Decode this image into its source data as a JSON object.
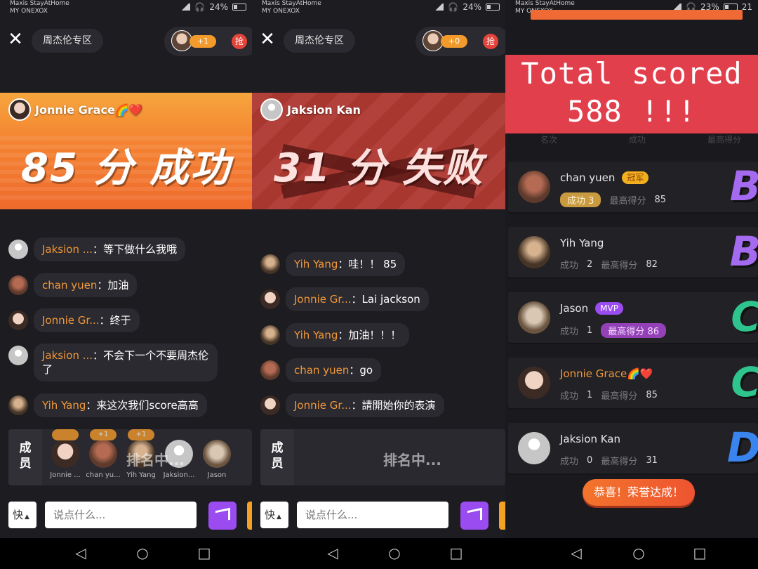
{
  "status_bars": [
    {
      "carrier1": "Maxis StayAtHome",
      "carrier2": "MY ONEXOX",
      "battery": "24%"
    },
    {
      "carrier1": "Maxis StayAtHome",
      "carrier2": "MY ONEXOX",
      "battery": "24%"
    },
    {
      "carrier1": "Maxis StayAtHome",
      "carrier2": "MY ONEXOX",
      "battery": "23%",
      "extra": "21"
    }
  ],
  "panel1": {
    "zone_title": "周杰伦专区",
    "plus_count": "+1",
    "grab_label": "抢",
    "banner": {
      "user": "Jonnie Grace🌈❤️",
      "result": "85 分 成功",
      "score": 85,
      "status": "成功"
    },
    "messages": [
      {
        "name": "Jaksion ...",
        "text": "等下做什么我哦"
      },
      {
        "name": "chan yuen",
        "text": "加油"
      },
      {
        "name": "Jonnie Gr...",
        "text": "终于"
      },
      {
        "name": "Jaksion ...",
        "text": "不会下一个不要周杰伦了"
      },
      {
        "name": "Yih Yang",
        "text": "来这次我们score高高"
      }
    ],
    "members_label": "成员",
    "members": [
      {
        "name": "Jonnie ...",
        "tag": ""
      },
      {
        "name": "chan yu...",
        "tag": "+1"
      },
      {
        "name": "Yih Yang",
        "tag": "+1"
      },
      {
        "name": "Jaksion...",
        "tag": ""
      },
      {
        "name": "Jason",
        "tag": ""
      }
    ],
    "ranking_overlay": "排名中...",
    "quick_label": "快",
    "input_placeholder": "说点什么..."
  },
  "panel2": {
    "zone_title": "周杰伦专区",
    "plus_count": "+0",
    "grab_label": "抢",
    "banner": {
      "user": "Jaksion Kan",
      "result": "31 分 失败",
      "score": 31,
      "status": "失败"
    },
    "messages": [
      {
        "name": "Yih Yang",
        "text": "哇！！ 85"
      },
      {
        "name": "Jonnie Gr...",
        "text": "Lai jackson"
      },
      {
        "name": "Yih Yang",
        "text": "加油！！！"
      },
      {
        "name": "chan yuen",
        "text": "go"
      },
      {
        "name": "Jonnie Gr...",
        "text": "請開始你的表演"
      }
    ],
    "members_label": "成员",
    "ranking_overlay": "排名中...",
    "quick_label": "快",
    "input_placeholder": "说点什么..."
  },
  "panel3": {
    "total_line1": "Total scored",
    "total_line2": "588 !!!",
    "columns": [
      "名次",
      "成功",
      "最高得分"
    ],
    "rows": [
      {
        "name": "chan yuen",
        "badge": "冠军",
        "success_label": "成功",
        "success": "3",
        "best_label": "最高得分",
        "best": "85",
        "grade": "B"
      },
      {
        "name": "Yih Yang",
        "badge": "",
        "success_label": "成功",
        "success": "2",
        "best_label": "最高得分",
        "best": "82",
        "grade": "B"
      },
      {
        "name": "Jason",
        "badge": "MVP",
        "success_label": "成功",
        "success": "1",
        "best_label": "最高得分",
        "best": "86",
        "grade": "C"
      },
      {
        "name": "Jonnie Grace🌈❤️",
        "badge": "",
        "success_label": "成功",
        "success": "1",
        "best_label": "最高得分",
        "best": "85",
        "grade": "C"
      },
      {
        "name": "Jaksion Kan",
        "badge": "",
        "success_label": "成功",
        "success": "0",
        "best_label": "最高得分",
        "best": "31",
        "grade": "D"
      }
    ],
    "congrats": "恭喜！荣誉达成！"
  },
  "colors": {
    "accent_orange": "#f0983a",
    "success_banner": "#ef6a2c",
    "fail_banner": "#b2413b",
    "total_bg": "#e23f4d",
    "share_purple": "#9b4cf1"
  }
}
